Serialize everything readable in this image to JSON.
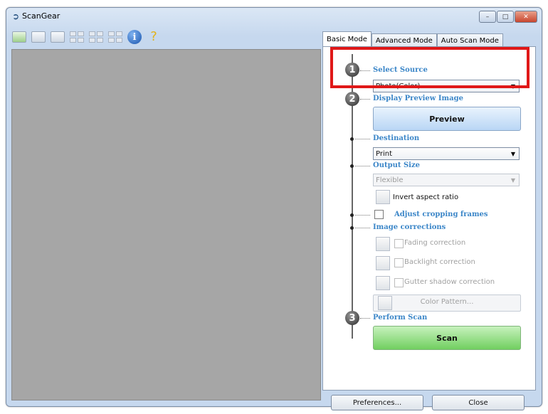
{
  "window": {
    "title": "ScanGear",
    "app_icon": "scanner-icon"
  },
  "titlebar_buttons": [
    {
      "name": "minimize",
      "glyph": "–"
    },
    {
      "name": "maximize",
      "glyph": "□"
    },
    {
      "name": "close",
      "glyph": "✕"
    }
  ],
  "tabs": [
    {
      "label": "Basic Mode",
      "active": true
    },
    {
      "label": "Advanced Mode",
      "active": false
    },
    {
      "label": "Auto Scan Mode",
      "active": false
    }
  ],
  "steps": {
    "step1": {
      "number": "1",
      "title": "Select Source",
      "source_value": "Photo(Color)"
    },
    "step2": {
      "number": "2",
      "title": "Display Preview Image",
      "preview_button": "Preview"
    },
    "destination": {
      "title": "Destination",
      "value": "Print"
    },
    "output_size": {
      "title": "Output Size",
      "value": "Flexible",
      "invert_label": "Invert aspect ratio"
    },
    "cropping": {
      "label": "Adjust cropping frames"
    },
    "image_corrections": {
      "title": "Image corrections",
      "fading": "Fading correction",
      "backlight": "Backlight correction",
      "gutter": "Gutter shadow correction",
      "color_pattern": "Color Pattern..."
    },
    "step3": {
      "number": "3",
      "title": "Perform Scan",
      "scan_button": "Scan"
    }
  },
  "footer": {
    "preferences": "Preferences...",
    "close": "Close"
  },
  "colors": {
    "highlight": "#e01818",
    "section_title": "#3b86c8",
    "scan_button": "#71cf60",
    "preview_button": "#b9d6f5"
  }
}
